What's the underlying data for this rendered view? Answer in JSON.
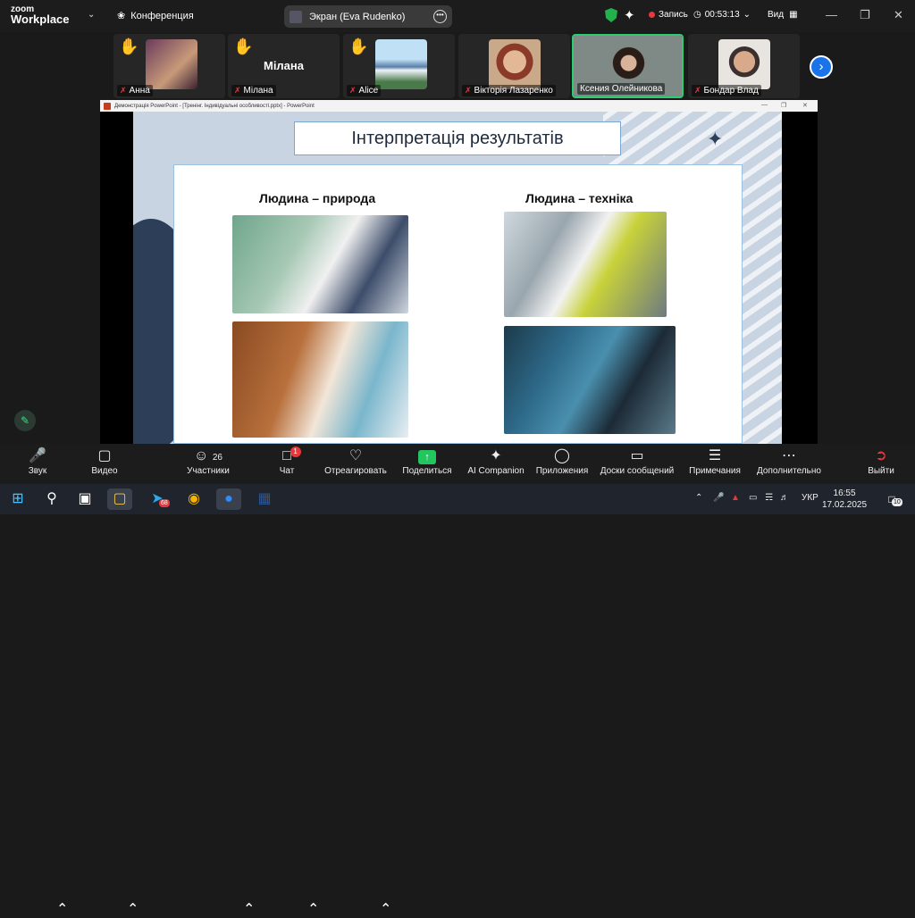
{
  "app": {
    "brand_top": "zoom",
    "brand_bottom": "Workplace"
  },
  "header": {
    "conference_label": "Конференция",
    "screen_label": "Экран (Eva Rudenko)",
    "record_label": "Запись",
    "timer": "00:53:13",
    "view_label": "Вид"
  },
  "participants": [
    {
      "name": "Анна",
      "hand_raised": true,
      "muted": true,
      "video": true
    },
    {
      "name": "Мілана",
      "hand_raised": true,
      "muted": true,
      "video": false,
      "big_name": "Мілана"
    },
    {
      "name": "Alice",
      "hand_raised": true,
      "muted": true,
      "video": true
    },
    {
      "name": "Вікторія Лазаренко",
      "hand_raised": false,
      "muted": true,
      "video": true
    },
    {
      "name": "Ксения Олейникова",
      "hand_raised": false,
      "muted": false,
      "video": true,
      "active": true
    },
    {
      "name": "Бондар Влад",
      "hand_raised": false,
      "muted": true,
      "video": true
    }
  ],
  "ppt": {
    "title": "Демонстрація PowerPoint - [Тренінг. Індивідуальні особливості.pptx] - PowerPoint"
  },
  "slide": {
    "title": "Інтерпретація результатів",
    "left_heading": "Людина – природа",
    "right_heading": "Людина – техніка"
  },
  "toolbar": {
    "audio": "Звук",
    "video": "Видео",
    "participants": "Участники",
    "participants_count": "26",
    "chat": "Чат",
    "chat_badge": "1",
    "react": "Отреагировать",
    "share": "Поделиться",
    "ai": "AI Companion",
    "apps": "Приложения",
    "boards": "Доски сообщений",
    "notes": "Примечания",
    "more": "Дополнительно",
    "leave": "Выйти"
  },
  "taskbar": {
    "telegram_badge": "68",
    "lang": "УКР",
    "time": "16:55",
    "date": "17.02.2025",
    "notifications": "10"
  },
  "colors": {
    "accent_green": "#22c55e",
    "mute_red": "#e8383d",
    "zoom_blue": "#1a73e8"
  }
}
